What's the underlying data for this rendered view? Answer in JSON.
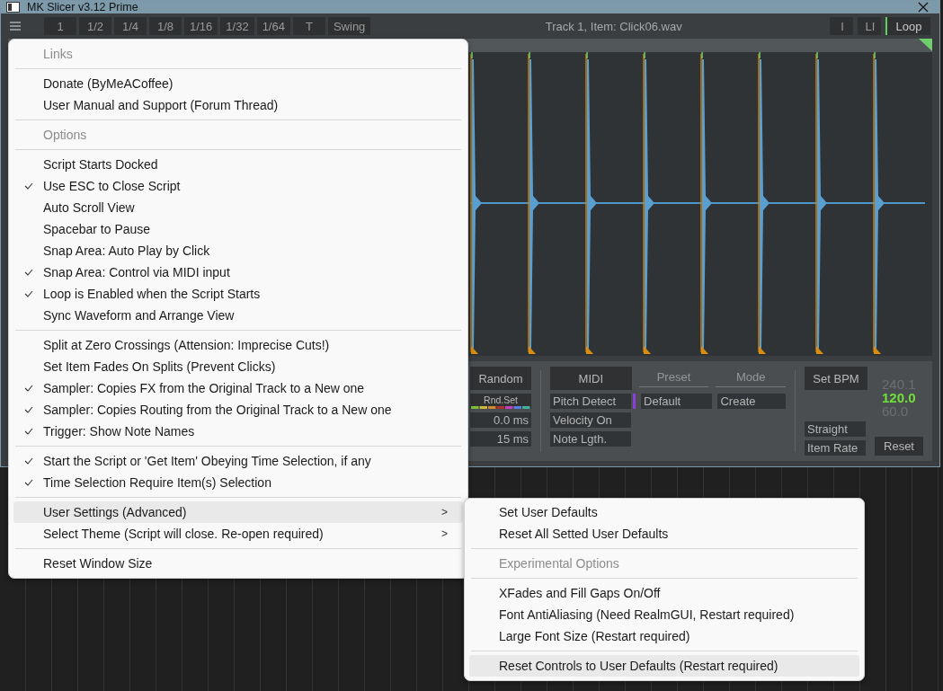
{
  "window": {
    "title": "MK Slicer v3.12 Prime"
  },
  "toolbar": {
    "grid_buttons": [
      "1",
      "1/2",
      "1/4",
      "1/8",
      "1/16",
      "1/32",
      "1/64",
      "T",
      "Swing"
    ],
    "item_info": "Track 1,  Item: Click06.wav",
    "view_buttons": [
      {
        "label": "I",
        "on": false
      },
      {
        "label": "LI",
        "on": false
      },
      {
        "label": "Loop",
        "on": true
      }
    ]
  },
  "bottom_panel": {
    "random_button": "Random",
    "rnd_set_button": "Rnd.Set",
    "offset_fields": [
      "0.0 ms",
      "15 ms"
    ],
    "midi_button": "MIDI",
    "preset_label": "Preset",
    "mode_label": "Mode",
    "midi_options": [
      {
        "label": "Pitch Detect",
        "color": "#8a3ee0"
      },
      {
        "label": "Velocity On"
      },
      {
        "label": "Note Lgth."
      }
    ],
    "preset_value": "Default",
    "mode_value": "Create",
    "set_bpm_button": "Set BPM",
    "bpm_values": [
      {
        "text": "240.1",
        "selected": false
      },
      {
        "text": "120.0",
        "selected": true
      },
      {
        "text": "60.0",
        "selected": false
      }
    ],
    "rate_options": [
      "Straight",
      "Item Rate"
    ],
    "reset_button": "Reset"
  },
  "menu": {
    "items": [
      {
        "kind": "header",
        "label": "Links"
      },
      {
        "kind": "separator"
      },
      {
        "kind": "item",
        "label": "Donate (ByMeACoffee)",
        "checked": false,
        "highlighted": false
      },
      {
        "kind": "item",
        "label": "User Manual and Support (Forum Thread)",
        "checked": false,
        "highlighted": false
      },
      {
        "kind": "separator"
      },
      {
        "kind": "header",
        "label": "Options"
      },
      {
        "kind": "separator"
      },
      {
        "kind": "item",
        "label": "Script Starts Docked",
        "checked": false,
        "highlighted": false
      },
      {
        "kind": "item",
        "label": "Use ESC to Close Script",
        "checked": true,
        "highlighted": false
      },
      {
        "kind": "item",
        "label": "Auto Scroll View",
        "checked": false,
        "highlighted": false
      },
      {
        "kind": "item",
        "label": "Spacebar to Pause",
        "checked": false,
        "highlighted": false
      },
      {
        "kind": "item",
        "label": "Snap Area: Auto Play by Click",
        "checked": false,
        "highlighted": false
      },
      {
        "kind": "item",
        "label": "Snap Area: Control via MIDI input",
        "checked": true,
        "highlighted": false
      },
      {
        "kind": "item",
        "label": "Loop is Enabled when the Script Starts",
        "checked": true,
        "highlighted": false
      },
      {
        "kind": "item",
        "label": "Sync Waveform and Arrange View",
        "checked": false,
        "highlighted": false
      },
      {
        "kind": "separator"
      },
      {
        "kind": "item",
        "label": "Split at Zero Crossings (Attension: Imprecise Cuts!)",
        "checked": false,
        "highlighted": false
      },
      {
        "kind": "item",
        "label": "Set Item Fades On Splits (Prevent Clicks)",
        "checked": false,
        "highlighted": false
      },
      {
        "kind": "item",
        "label": "Sampler: Copies FX from the Original Track to a New one",
        "checked": true,
        "highlighted": false
      },
      {
        "kind": "item",
        "label": "Sampler: Copies Routing from the Original Track to a New one",
        "checked": true,
        "highlighted": false
      },
      {
        "kind": "item",
        "label": "Trigger: Show Note Names",
        "checked": true,
        "highlighted": false
      },
      {
        "kind": "separator"
      },
      {
        "kind": "item",
        "label": "Start the Script or 'Get Item' Obeying Time Selection, if any",
        "checked": true,
        "highlighted": false
      },
      {
        "kind": "item",
        "label": "Time Selection Require Item(s) Selection",
        "checked": true,
        "highlighted": false
      },
      {
        "kind": "separator"
      },
      {
        "kind": "submenu",
        "label": "User Settings (Advanced)",
        "arrow": ">",
        "highlighted": true
      },
      {
        "kind": "submenu",
        "label": "Select Theme (Script will close. Re-open required)",
        "arrow": ">",
        "highlighted": false
      },
      {
        "kind": "separator"
      },
      {
        "kind": "item",
        "label": "Reset Window Size",
        "checked": false,
        "highlighted": false
      }
    ]
  },
  "submenu": {
    "items": [
      {
        "kind": "item",
        "label": "Set User Defaults",
        "checked": false,
        "highlighted": false
      },
      {
        "kind": "item",
        "label": "Reset All Setted User Defaults",
        "checked": false,
        "highlighted": false
      },
      {
        "kind": "separator"
      },
      {
        "kind": "header",
        "label": "Experimental Options"
      },
      {
        "kind": "separator"
      },
      {
        "kind": "item",
        "label": "XFades and Fill Gaps On/Off",
        "checked": false,
        "highlighted": false
      },
      {
        "kind": "item",
        "label": "Font AntiAliasing (Need RealmGUI, Restart required)",
        "checked": false,
        "highlighted": false
      },
      {
        "kind": "item",
        "label": "Large Font Size (Restart required)",
        "checked": false,
        "highlighted": false
      },
      {
        "kind": "separator"
      },
      {
        "kind": "item",
        "label": "Reset Controls to User Defaults (Restart required)",
        "checked": false,
        "highlighted": true
      }
    ]
  }
}
